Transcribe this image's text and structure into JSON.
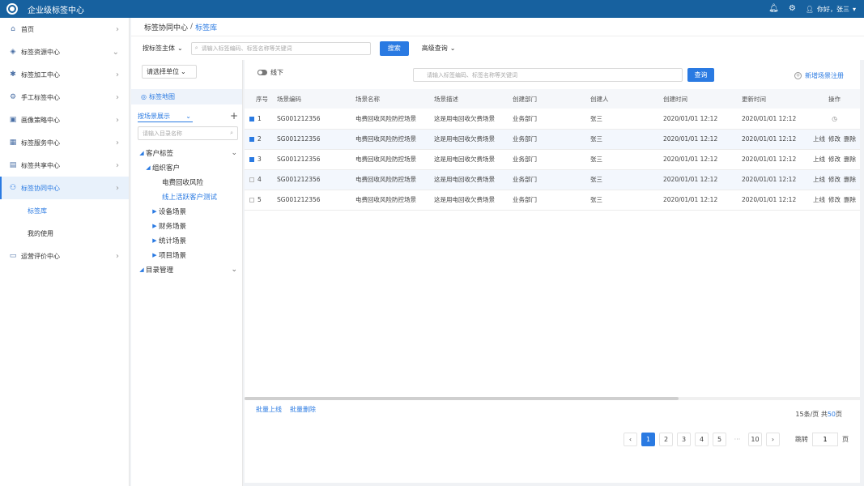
{
  "app": {
    "title": "企业级标签中心"
  },
  "topbar": {
    "bell_icon": "bell-icon",
    "settings_icon": "gear-icon",
    "user_greeting": "你好，张三"
  },
  "sidebar": {
    "items": [
      {
        "label": "首页",
        "icon": "home-icon"
      },
      {
        "label": "标签资源中心",
        "icon": "layers-icon"
      },
      {
        "label": "标签加工中心",
        "icon": "process-icon"
      },
      {
        "label": "手工标签中心",
        "icon": "manual-icon"
      },
      {
        "label": "画像策略中心",
        "icon": "portrait-icon"
      },
      {
        "label": "标签服务中心",
        "icon": "grid-icon"
      },
      {
        "label": "标签共享中心",
        "icon": "folder-share-icon"
      },
      {
        "label": "标签协同中心",
        "icon": "cooperate-icon"
      },
      {
        "label": "运营评价中心",
        "icon": "evaluate-icon"
      }
    ],
    "sub_items": [
      {
        "label": "标签库"
      },
      {
        "label": "我的使用"
      }
    ]
  },
  "breadcrumb": {
    "parent": "标签协同中心",
    "separator": "/",
    "current": "标签库"
  },
  "search": {
    "subject_select": "按标签主体",
    "placeholder": "请输入标签编码、标签名称等关键词",
    "search_button": "搜索",
    "advanced": "高级查询"
  },
  "tree_panel": {
    "unit_select": "请选择单位",
    "tag_map": "标签地图",
    "scene_select": "按场景展示",
    "add": "+",
    "dir_placeholder": "请输入目录名称",
    "nodes": [
      {
        "label": "客户标签"
      },
      {
        "label": "组织客户"
      },
      {
        "label": "电费回收风险"
      },
      {
        "label": "线上活跃客户测试"
      },
      {
        "label": "设备场景"
      },
      {
        "label": "财务场景"
      },
      {
        "label": "统计场景"
      },
      {
        "label": "项目场景"
      },
      {
        "label": "目录管理"
      }
    ]
  },
  "main": {
    "toggle_label": "线下",
    "search_placeholder": "请输入标签编码、标签名称等关键词",
    "query_button": "查询",
    "add_scene": "新增场景注册",
    "columns": [
      "序号",
      "场景编码",
      "场景名称",
      "场景描述",
      "创建部门",
      "创建人",
      "创建时间",
      "更新时间",
      "操作"
    ],
    "rows": [
      {
        "idx": "1",
        "code": "SG001212356",
        "name": "电费回收风险防控场景",
        "desc": "这是用电回收欠费场景",
        "dept": "业务部门",
        "creator": "张三",
        "created": "2020/01/01 12:12",
        "updated": "2020/01/01 12:12",
        "checked": true
      },
      {
        "idx": "2",
        "code": "SG001212356",
        "name": "电费回收风险防控场景",
        "desc": "这是用电回收欠费场景",
        "dept": "业务部门",
        "creator": "张三",
        "created": "2020/01/01 12:12",
        "updated": "2020/01/01 12:12",
        "checked": true
      },
      {
        "idx": "3",
        "code": "SG001212356",
        "name": "电费回收风险防控场景",
        "desc": "这是用电回收欠费场景",
        "dept": "业务部门",
        "creator": "张三",
        "created": "2020/01/01 12:12",
        "updated": "2020/01/01 12:12",
        "checked": true
      },
      {
        "idx": "4",
        "code": "SG001212356",
        "name": "电费回收风险防控场景",
        "desc": "这是用电回收欠费场景",
        "dept": "业务部门",
        "creator": "张三",
        "created": "2020/01/01 12:12",
        "updated": "2020/01/01 12:12",
        "checked": false
      },
      {
        "idx": "5",
        "code": "SG001212356",
        "name": "电费回收风险防控场景",
        "desc": "这是用电回收欠费场景",
        "dept": "业务部门",
        "creator": "张三",
        "created": "2020/01/01 12:12",
        "updated": "2020/01/01 12:12",
        "checked": false
      }
    ],
    "ops": {
      "online": "上线",
      "edit": "修改",
      "delete": "删除"
    },
    "batch_online": "批量上线",
    "batch_delete": "批量删除",
    "page_size": "15条/页",
    "total_prefix": "共",
    "total_count": "50",
    "total_suffix": "页"
  },
  "pagination": {
    "prev": "‹",
    "next": "›",
    "pages": [
      "1",
      "2",
      "3",
      "4",
      "5"
    ],
    "ellipsis": "···",
    "last": "10",
    "jump_label": "跳转",
    "jump_value": "1",
    "jump_suffix": "页"
  },
  "colors": {
    "topbar": "#17619f",
    "accent": "#2a7ae2"
  }
}
